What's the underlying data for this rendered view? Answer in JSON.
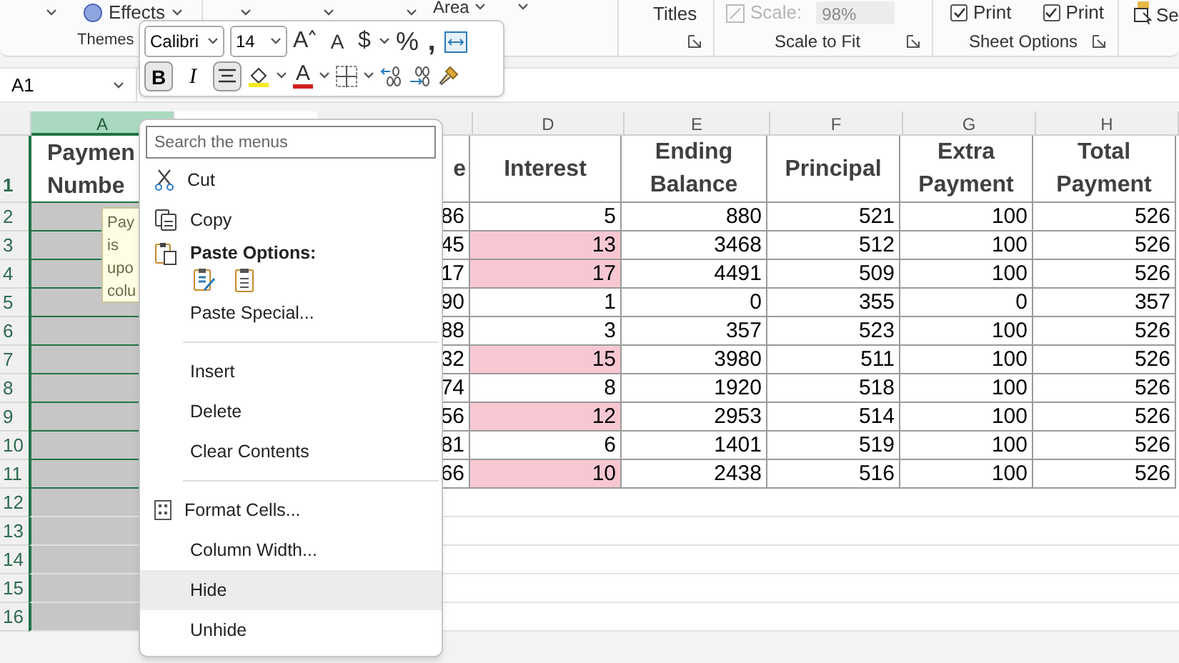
{
  "ribbon": {
    "effects_label": "Effects",
    "area_label": "Area",
    "titles_label": "Titles",
    "themes_label": "Themes",
    "scale": {
      "label": "Scale:",
      "value": "98%",
      "disabled": true
    },
    "scale_group_label": "Scale to Fit",
    "print_checks": [
      {
        "label": "Print",
        "checked": true
      },
      {
        "label": "Print",
        "checked": true
      }
    ],
    "sheet_group_label": "Sheet Options",
    "select_label": "Se"
  },
  "mini_toolbar": {
    "font": "Calibri",
    "size": "14",
    "grow": "A",
    "shrink": "A",
    "currency": "$",
    "percent": "%",
    "comma": ",",
    "bold": {
      "label": "B",
      "on": true
    },
    "italic": {
      "label": "I",
      "on": false
    },
    "center_on": true,
    "font_color": "A"
  },
  "name_box": "A1",
  "column_headers": [
    {
      "letter": "A",
      "selected": true
    },
    {
      "letter": "D",
      "selected": false
    },
    {
      "letter": "E",
      "selected": false
    },
    {
      "letter": "F",
      "selected": false
    },
    {
      "letter": "G",
      "selected": false
    },
    {
      "letter": "H",
      "selected": false
    }
  ],
  "table": {
    "header": {
      "number": "1",
      "col_a": [
        "Paymen",
        "Numbe"
      ],
      "col_c": "e",
      "rest": [
        "Interest",
        "Ending Balance",
        "Principal",
        "Extra Payment",
        "Total Payment"
      ]
    },
    "rows": [
      {
        "number": "2",
        "c": "86",
        "interest": "5",
        "highlighted": false,
        "ending_balance": "880",
        "principal": "521",
        "extra_payment": "100",
        "total_payment": "526"
      },
      {
        "number": "3",
        "c": "45",
        "interest": "13",
        "highlighted": true,
        "ending_balance": "3468",
        "principal": "512",
        "extra_payment": "100",
        "total_payment": "526"
      },
      {
        "number": "4",
        "c": "17",
        "interest": "17",
        "highlighted": true,
        "ending_balance": "4491",
        "principal": "509",
        "extra_payment": "100",
        "total_payment": "526"
      },
      {
        "number": "5",
        "c": "90",
        "interest": "1",
        "highlighted": false,
        "ending_balance": "0",
        "principal": "355",
        "extra_payment": "0",
        "total_payment": "357"
      },
      {
        "number": "6",
        "c": "88",
        "interest": "3",
        "highlighted": false,
        "ending_balance": "357",
        "principal": "523",
        "extra_payment": "100",
        "total_payment": "526"
      },
      {
        "number": "7",
        "c": "32",
        "interest": "15",
        "highlighted": true,
        "ending_balance": "3980",
        "principal": "511",
        "extra_payment": "100",
        "total_payment": "526"
      },
      {
        "number": "8",
        "c": "74",
        "interest": "8",
        "highlighted": false,
        "ending_balance": "1920",
        "principal": "518",
        "extra_payment": "100",
        "total_payment": "526"
      },
      {
        "number": "9",
        "c": "56",
        "interest": "12",
        "highlighted": true,
        "ending_balance": "2953",
        "principal": "514",
        "extra_payment": "100",
        "total_payment": "526"
      },
      {
        "number": "10",
        "c": "81",
        "interest": "6",
        "highlighted": false,
        "ending_balance": "1401",
        "principal": "519",
        "extra_payment": "100",
        "total_payment": "526"
      },
      {
        "number": "11",
        "c": "66",
        "interest": "10",
        "highlighted": true,
        "ending_balance": "2438",
        "principal": "516",
        "extra_payment": "100",
        "total_payment": "526"
      }
    ],
    "empty_rows": [
      "12",
      "13",
      "14",
      "15",
      "16"
    ]
  },
  "tooltip": {
    "lines": [
      "Pay",
      "is",
      "upo",
      "colu"
    ]
  },
  "context_menu": {
    "search_placeholder": "Search the menus",
    "items": [
      {
        "kind": "command",
        "label": "Cut",
        "hovered": false
      },
      {
        "kind": "command",
        "label": "Copy",
        "hovered": false
      },
      {
        "kind": "heading",
        "label": "Paste Options:"
      },
      {
        "kind": "paste-choices"
      },
      {
        "kind": "command",
        "label": "Paste Special...",
        "hovered": false
      },
      {
        "kind": "separator"
      },
      {
        "kind": "command",
        "label": "Insert",
        "hovered": false
      },
      {
        "kind": "command",
        "label": "Delete",
        "hovered": false
      },
      {
        "kind": "command",
        "label": "Clear Contents",
        "hovered": false
      },
      {
        "kind": "separator"
      },
      {
        "kind": "command",
        "label": "Format Cells...",
        "hovered": false
      },
      {
        "kind": "command",
        "label": "Column Width...",
        "hovered": false
      },
      {
        "kind": "command",
        "label": "Hide",
        "hovered": true
      },
      {
        "kind": "command",
        "label": "Unhide",
        "hovered": false
      }
    ]
  }
}
